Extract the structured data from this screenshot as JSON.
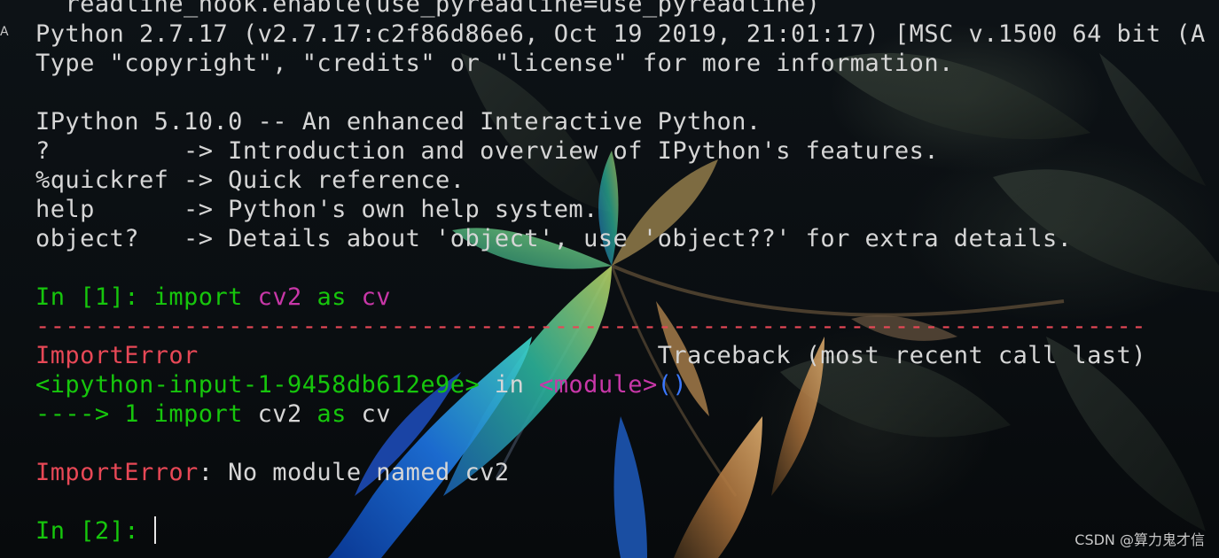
{
  "terminal": {
    "edge_char": "A",
    "lines": {
      "l0": "  readline_hook.enable(use_pyreadline=use_pyreadline)",
      "l1": "Python 2.7.17 (v2.7.17:c2f86d86e6, Oct 19 2019, 21:01:17) [MSC v.1500 64 bit (A",
      "l2": "Type \"copyright\", \"credits\" or \"license\" for more information.",
      "l4": "IPython 5.10.0 -- An enhanced Interactive Python.",
      "l5": "?         -> Introduction and overview of IPython's features.",
      "l6": "%quickref -> Quick reference.",
      "l7": "help      -> Python's own help system.",
      "l8": "object?   -> Details about 'object', use 'object??' for extra details."
    },
    "prompt1": {
      "prompt": "In [1]: ",
      "kw_import": "import",
      "space1": " ",
      "module": "cv2",
      "space2": " ",
      "kw_as": "as",
      "space3": " ",
      "alias": "cv"
    },
    "separator": "---------------------------------------------------------------------------",
    "error_header": {
      "name": "ImportError",
      "gap": "                               ",
      "traceback": "Traceback (most recent call last)"
    },
    "frame": {
      "file": "<ipython-input-1-9458db612e9e>",
      "in_text": " in ",
      "module": "<module>",
      "parens": "()"
    },
    "arrow_line": {
      "arrow": "----> 1 ",
      "kw_import": "import",
      "rest1": " cv2 ",
      "kw_as": "as",
      "rest2": " cv"
    },
    "error_line": {
      "name": "ImportError",
      "message": ": No module named cv2"
    },
    "prompt2": "In [2]: "
  },
  "watermark": "CSDN @算力鬼才信",
  "colors": {
    "background": "#0b0f12",
    "text": "#d6d6d6",
    "prompt_green": "#16c60c",
    "identifier_magenta": "#c837a8",
    "error_red": "#e74856",
    "paren_blue": "#3b78ff"
  }
}
